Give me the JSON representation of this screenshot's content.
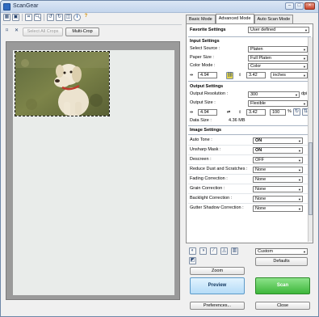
{
  "window": {
    "title": "ScanGear"
  },
  "toolbar": {
    "icons": [
      "thumbnail-icon",
      "whole-image-icon",
      "zoom-icon",
      "rotate-left-icon",
      "rotate-right-icon",
      "auto-crop-icon",
      "info-icon",
      "help-icon"
    ],
    "select_all_crops": "Select All Crops",
    "multi_crop": "Multi-Crop"
  },
  "tabs": [
    "Basic Mode",
    "Advanced Mode",
    "Auto Scan Mode"
  ],
  "favorite": {
    "label": "Favorite Settings",
    "value": "User defined"
  },
  "input_settings": {
    "title": "Input Settings",
    "select_source_label": "Select Source :",
    "select_source": "Platen",
    "paper_size_label": "Paper Size :",
    "paper_size": "Full Platen",
    "color_mode_label": "Color Mode :",
    "color_mode": "Color",
    "width": "4.94",
    "height": "3.42",
    "unit": "inches"
  },
  "output_settings": {
    "title": "Output Settings",
    "resolution_label": "Output Resolution :",
    "resolution": "300",
    "resolution_unit": "dpi",
    "output_size_label": "Output Size :",
    "output_size": "Flexible",
    "width": "4.94",
    "height": "3.42",
    "scale": "100",
    "scale_unit": "%",
    "data_size_label": "Data Size :",
    "data_size": "4.36 MB"
  },
  "image_settings": {
    "title": "Image Settings",
    "rows": [
      {
        "label": "Auto Tone :",
        "value": "ON",
        "bold": true
      },
      {
        "label": "Unsharp Mask :",
        "value": "ON",
        "bold": true
      },
      {
        "label": "Descreen :",
        "value": "OFF",
        "bold": false
      },
      {
        "label": "Reduce Dust and Scratches :",
        "value": "None",
        "bold": false
      },
      {
        "label": "Fading Correction :",
        "value": "None",
        "bold": false
      },
      {
        "label": "Grain Correction :",
        "value": "None",
        "bold": false
      },
      {
        "label": "Backlight Correction :",
        "value": "None",
        "bold": false
      },
      {
        "label": "Gutter Shadow Correction :",
        "value": "None",
        "bold": false
      }
    ]
  },
  "adjust": {
    "tone_preset": "Custom",
    "defaults": "Defaults"
  },
  "buttons": {
    "zoom": "Zoom",
    "preview": "Preview",
    "scan": "Scan",
    "preferences": "Preferences...",
    "close": "Close"
  },
  "colors": {
    "preview_btn": "#c8e6fb",
    "scan_btn": "#50c84e",
    "title_bar": "#c3d5ec"
  }
}
